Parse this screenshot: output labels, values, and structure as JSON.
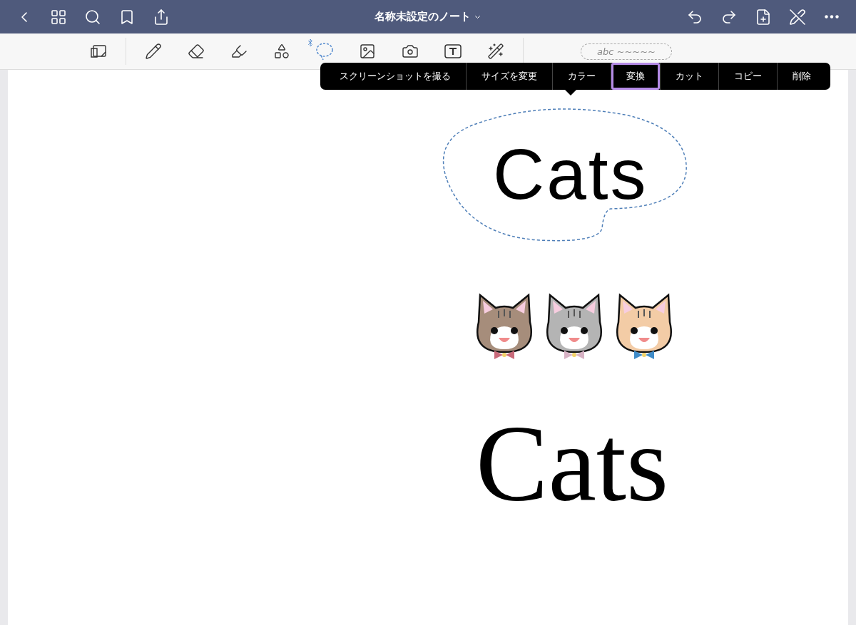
{
  "window": {
    "title": "名称未設定のノート"
  },
  "tools": [
    {
      "kind": "page",
      "selected": false
    },
    {
      "kind": "pen",
      "selected": false
    },
    {
      "kind": "eraser",
      "selected": false
    },
    {
      "kind": "highlighter",
      "selected": false
    },
    {
      "kind": "shapes",
      "selected": false
    },
    {
      "kind": "lasso",
      "selected": true
    },
    {
      "kind": "image",
      "selected": false
    },
    {
      "kind": "camera",
      "selected": false
    },
    {
      "kind": "textbox",
      "selected": false
    },
    {
      "kind": "laser",
      "selected": false
    }
  ],
  "handwriting_hint": "abc ~~~~~",
  "context_menu": [
    {
      "label": "スクリーンショットを撮る",
      "selected": false
    },
    {
      "label": "サイズを変更",
      "selected": false
    },
    {
      "label": "カラー",
      "selected": false
    },
    {
      "label": "変換",
      "selected": true
    },
    {
      "label": "カット",
      "selected": false
    },
    {
      "label": "コピー",
      "selected": false
    },
    {
      "label": "削除",
      "selected": false
    }
  ],
  "canvas": {
    "handwritten_text": "Cats",
    "typed_text": "Cats",
    "cats": [
      {
        "color": "#a68d7b"
      },
      {
        "color": "#b4b4b4"
      },
      {
        "color": "#f3cca6"
      }
    ]
  }
}
